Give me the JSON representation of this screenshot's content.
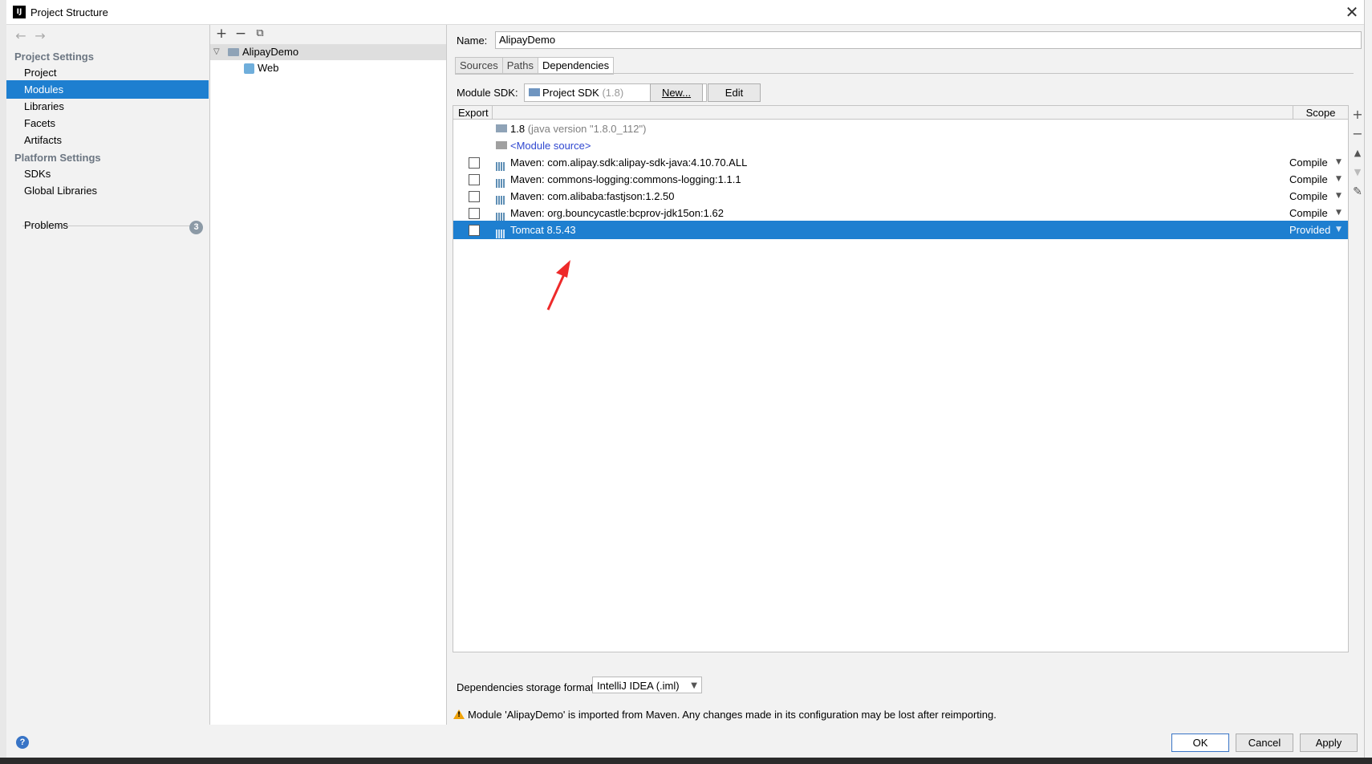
{
  "window": {
    "title": "Project Structure"
  },
  "sidebar": {
    "project_settings_title": "Project Settings",
    "project_items": [
      {
        "label": "Project"
      },
      {
        "label": "Modules"
      },
      {
        "label": "Libraries"
      },
      {
        "label": "Facets"
      },
      {
        "label": "Artifacts"
      }
    ],
    "platform_settings_title": "Platform Settings",
    "platform_items": [
      {
        "label": "SDKs"
      },
      {
        "label": "Global Libraries"
      }
    ],
    "problems_label": "Problems",
    "problems_count": "3"
  },
  "modules_tree": {
    "root": "AlipayDemo",
    "child": "Web"
  },
  "module": {
    "name_label": "Name:",
    "name_value": "AlipayDemo",
    "tabs": [
      {
        "label": "Sources"
      },
      {
        "label": "Paths"
      },
      {
        "label": "Dependencies"
      }
    ],
    "sdk_label": "Module SDK:",
    "sdk_value": "Project SDK",
    "sdk_version": "(1.8)",
    "new_button": "New...",
    "edit_button": "Edit",
    "table": {
      "col_export": "Export",
      "col_scope": "Scope",
      "jdk_name": "1.8",
      "jdk_detail": "(java version \"1.8.0_112\")",
      "module_source": "<Module source>",
      "rows": [
        {
          "name": "Maven: com.alipay.sdk:alipay-sdk-java:4.10.70.ALL",
          "scope": "Compile"
        },
        {
          "name": "Maven: commons-logging:commons-logging:1.1.1",
          "scope": "Compile"
        },
        {
          "name": "Maven: com.alibaba:fastjson:1.2.50",
          "scope": "Compile"
        },
        {
          "name": "Maven: org.bouncycastle:bcprov-jdk15on:1.62",
          "scope": "Compile"
        },
        {
          "name": "Tomcat 8.5.43",
          "scope": "Provided"
        }
      ]
    },
    "storage_format_label": "Dependencies storage format:",
    "storage_format_value": "IntelliJ IDEA (.iml)",
    "warning": "Module 'AlipayDemo' is imported from Maven. Any changes made in its configuration may be lost after reimporting."
  },
  "footer": {
    "help": "?",
    "ok": "OK",
    "cancel": "Cancel",
    "apply": "Apply"
  },
  "icons": {
    "close": "close-icon",
    "back": "arrow-left-icon",
    "forward": "arrow-right-icon",
    "add": "plus-icon",
    "remove": "minus-icon",
    "copy": "copy-icon",
    "library": "library-icon",
    "folder": "folder-icon",
    "warning": "warning-icon"
  },
  "colors": {
    "selection": "#1e7fd0",
    "section_title": "#6c7682",
    "link": "#2f47d0",
    "annotation_arrow": "#ee2a2a"
  }
}
